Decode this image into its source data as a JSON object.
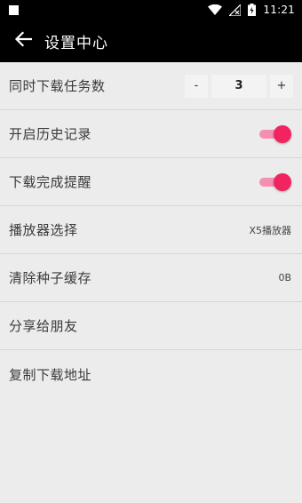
{
  "status_bar": {
    "time": "11:21",
    "icons": [
      "notification-square-icon",
      "wifi-icon",
      "no-signal-icon",
      "battery-charging-icon"
    ]
  },
  "header": {
    "title": "设置中心",
    "back_icon": "arrow-left-icon"
  },
  "settings": {
    "concurrent_downloads": {
      "label": "同时下载任务数",
      "value": "3",
      "decrement": "-",
      "increment": "+"
    },
    "history": {
      "label": "开启历史记录",
      "enabled": true
    },
    "download_reminder": {
      "label": "下载完成提醒",
      "enabled": true
    },
    "player": {
      "label": "播放器选择",
      "value": "X5播放器"
    },
    "clear_cache": {
      "label": "清除种子缓存",
      "value": "0B"
    },
    "share": {
      "label": "分享给朋友"
    },
    "copy_address": {
      "label": "复制下载地址"
    }
  },
  "colors": {
    "accent": "#f0245e",
    "track": "#f48fb1",
    "background": "#ececec",
    "appbar": "#000000"
  }
}
